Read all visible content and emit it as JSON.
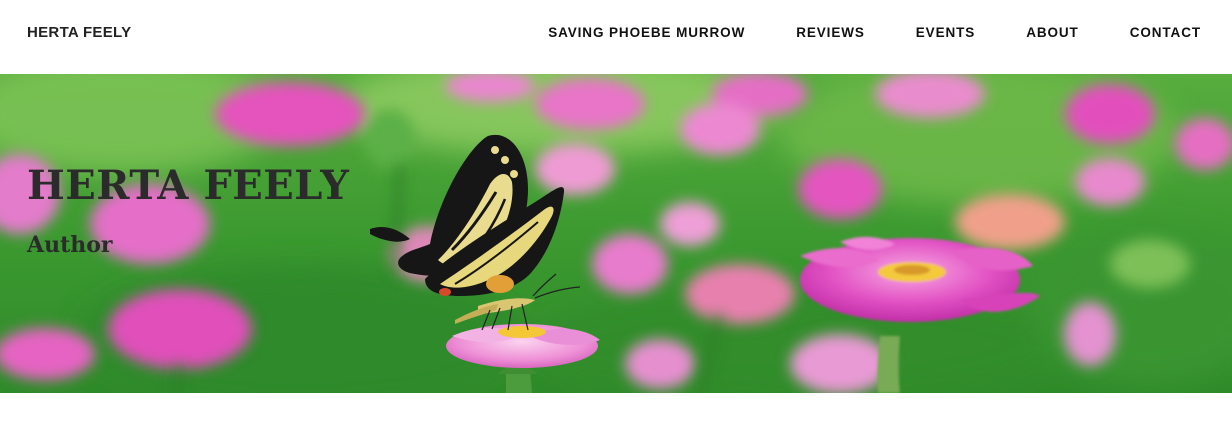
{
  "header": {
    "site_title": "HERTA FEELY",
    "nav": [
      {
        "label": "SAVING PHOEBE MURROW"
      },
      {
        "label": "REVIEWS"
      },
      {
        "label": "EVENTS"
      },
      {
        "label": "ABOUT"
      },
      {
        "label": "CONTACT"
      }
    ]
  },
  "hero": {
    "title": "HERTA FEELY",
    "subtitle": "Author",
    "image": "butterfly-on-pink-zinnia-field",
    "colors": {
      "foliage": "#3f9a32",
      "flower": "#e84fb8",
      "title_text": "#2b2b2b"
    }
  }
}
